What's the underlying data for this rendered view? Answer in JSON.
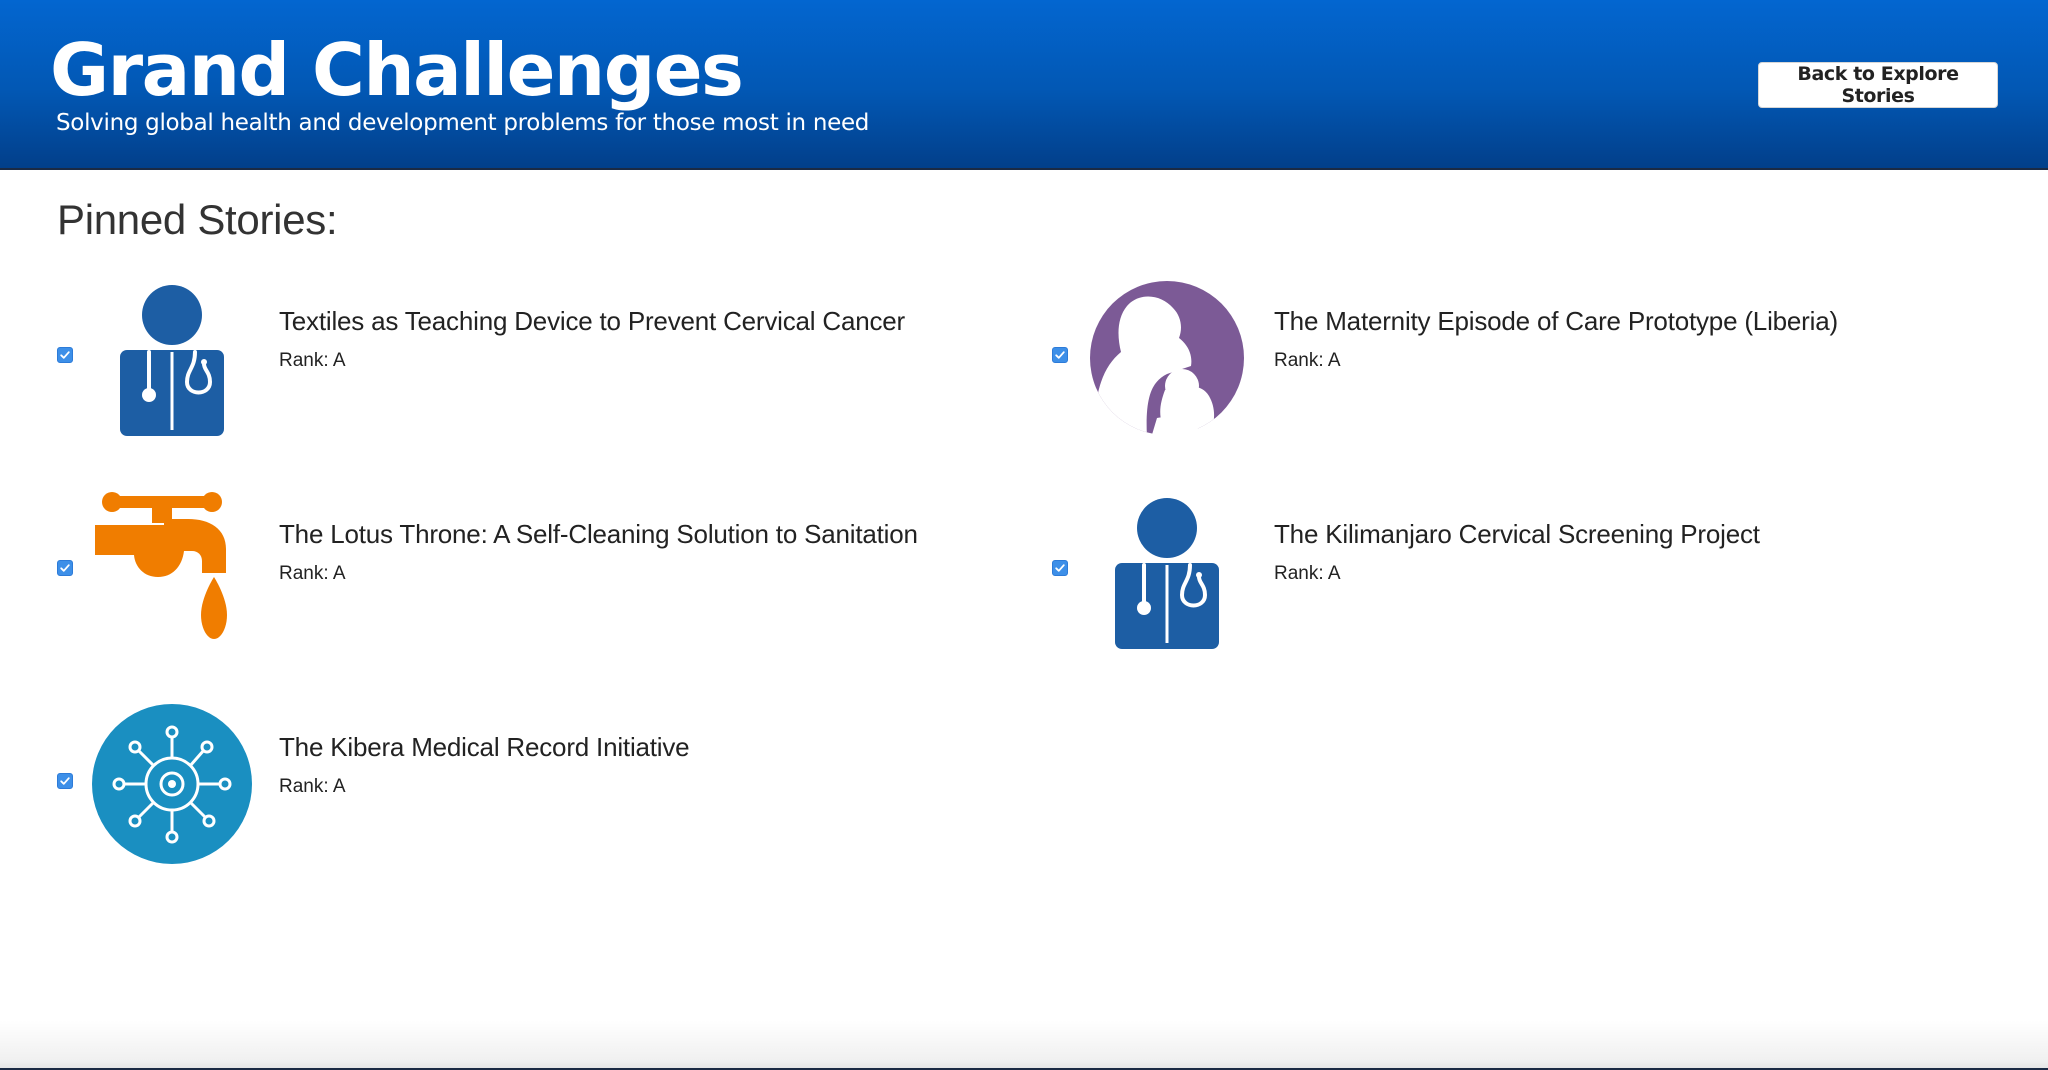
{
  "header": {
    "title": "Grand Challenges",
    "tagline": "Solving global health and development problems for those most in need",
    "back_button_label": "Back to Explore Stories"
  },
  "colors": {
    "header_blue": "#0366d0",
    "doctor_blue": "#1d5ea4",
    "faucet_orange": "#f07d00",
    "mother_purple": "#7c5a96",
    "virus_teal": "#1a8fc1",
    "checkbox_blue": "#3d8fe8"
  },
  "section_title": "Pinned Stories:",
  "stories": [
    {
      "title": "Textiles as Teaching Device to Prevent Cervical Cancer",
      "rank": "Rank: A",
      "pinned": true,
      "icon": "doctor-icon"
    },
    {
      "title": "The Maternity Episode of Care Prototype (Liberia)",
      "rank": "Rank: A",
      "pinned": true,
      "icon": "mother-child-icon"
    },
    {
      "title": "The Lotus Throne: A Self-Cleaning Solution to Sanitation",
      "rank": "Rank: A",
      "pinned": true,
      "icon": "faucet-icon"
    },
    {
      "title": "The Kilimanjaro Cervical Screening Project",
      "rank": "Rank: A",
      "pinned": true,
      "icon": "doctor-icon"
    },
    {
      "title": "The Kibera Medical Record Initiative",
      "rank": "Rank: A",
      "pinned": true,
      "icon": "virus-icon"
    }
  ]
}
